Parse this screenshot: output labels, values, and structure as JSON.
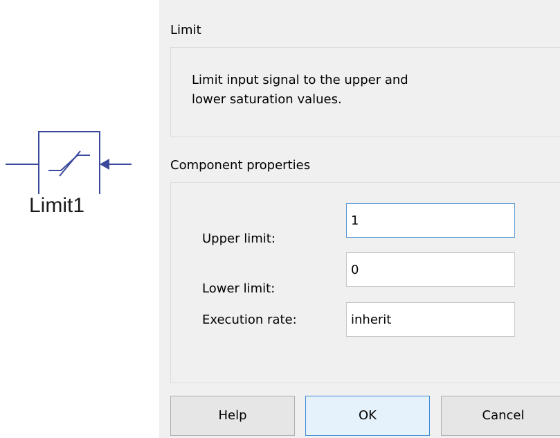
{
  "block": {
    "name": "Limit1",
    "icon": "saturation-icon"
  },
  "dialog": {
    "title": "Limit",
    "description": "Limit input signal to the upper and\nlower saturation values.",
    "properties_title": "Component properties",
    "fields": [
      {
        "label": "Upper limit:",
        "value": "1"
      },
      {
        "label": "Lower limit:",
        "value": "0"
      },
      {
        "label": "Execution rate:",
        "value": "inherit"
      }
    ],
    "buttons": {
      "help": "Help",
      "ok": "OK",
      "cancel": "Cancel"
    }
  },
  "colors": {
    "block_stroke": "#3b4a9b",
    "dialog_bg": "#f0f0f0",
    "focus_border": "#5b9bd5"
  }
}
